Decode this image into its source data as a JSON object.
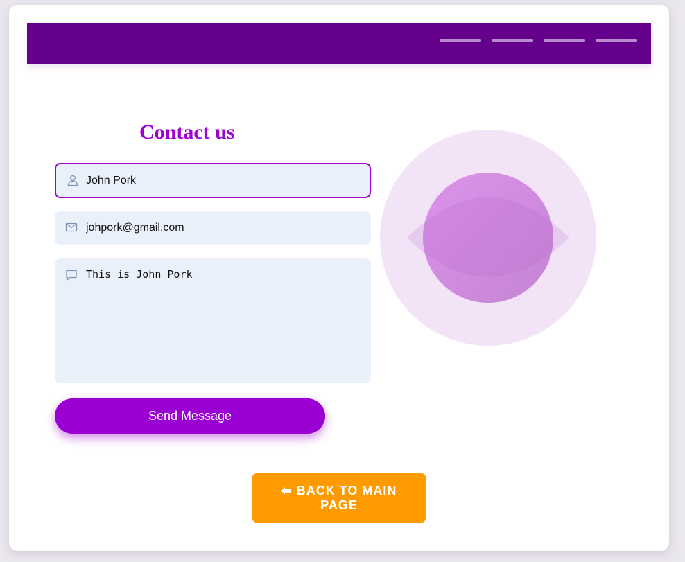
{
  "header": {
    "nav_items": [
      "",
      "",
      "",
      ""
    ],
    "background_color": "#64008c"
  },
  "form": {
    "title": "Contact us",
    "name": {
      "value": "John Pork",
      "icon": "user-icon"
    },
    "email": {
      "value": "johpork@gmail.com",
      "icon": "mail-icon"
    },
    "message": {
      "value": "This is John Pork",
      "icon": "message-icon"
    },
    "send_label": "Send Message"
  },
  "back_button": {
    "label": "⬅ BACK TO MAIN PAGE"
  },
  "colors": {
    "accent": "#a000d2",
    "send_button": "#9b00d3",
    "back_button": "#ff9b00",
    "field_background": "#eaf0fa"
  }
}
